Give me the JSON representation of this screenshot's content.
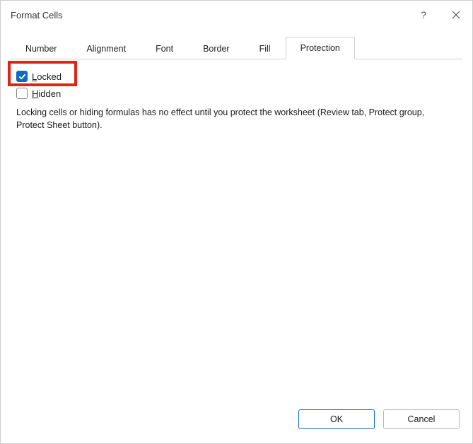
{
  "titlebar": {
    "title": "Format Cells",
    "help_icon": "help-icon",
    "close_icon": "close-icon"
  },
  "tabs": [
    {
      "label": "Number"
    },
    {
      "label": "Alignment"
    },
    {
      "label": "Font"
    },
    {
      "label": "Border"
    },
    {
      "label": "Fill"
    },
    {
      "label": "Protection"
    }
  ],
  "active_tab_index": 5,
  "protection": {
    "locked": {
      "accelerator": "L",
      "rest": "ocked",
      "checked": true
    },
    "hidden": {
      "accelerator": "H",
      "rest": "idden",
      "checked": false
    },
    "description": "Locking cells or hiding formulas has no effect until you protect the worksheet (Review tab, Protect group, Protect Sheet button)."
  },
  "footer": {
    "ok_label": "OK",
    "cancel_label": "Cancel"
  },
  "highlight": {
    "target": "locked"
  }
}
